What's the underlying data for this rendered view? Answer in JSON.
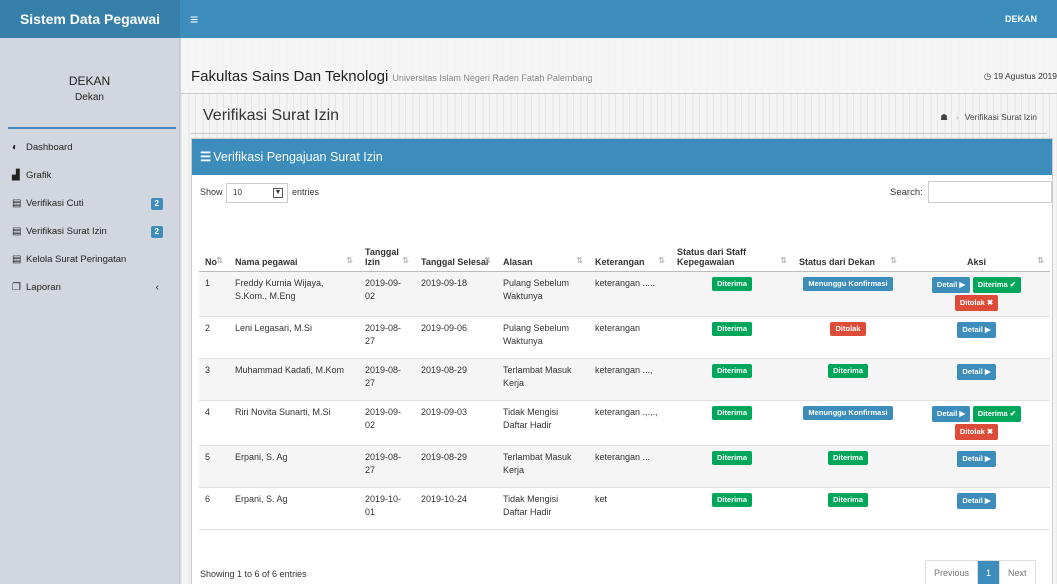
{
  "app": {
    "brand": "Sistem Data Pegawai",
    "menu_icon": "≡",
    "user_menu": "DEKAN"
  },
  "sidebar": {
    "user_name": "DEKAN",
    "user_role": "Dekan",
    "items": [
      {
        "label": "Dashboard",
        "icon": "dashboard-icon",
        "glyph": "◐"
      },
      {
        "label": "Grafik",
        "icon": "bar-chart-icon",
        "glyph": "▟"
      },
      {
        "label": "Verifikasi Cuti",
        "icon": "table-icon",
        "glyph": "▤",
        "badge": "2"
      },
      {
        "label": "Verifikasi Surat Izin",
        "icon": "table-icon",
        "glyph": "▤",
        "badge": "2"
      },
      {
        "label": "Kelola Surat Peringatan",
        "icon": "table-icon",
        "glyph": "▤"
      },
      {
        "label": "Laporan",
        "icon": "copy-icon",
        "glyph": "❐",
        "caret": "‹"
      }
    ]
  },
  "header": {
    "faculty": "Fakultas Sains Dan Teknologi",
    "university": "Universitas Islam Negeri Raden Fatah Palembang",
    "date": "◷ 19 Agustus 2019"
  },
  "page": {
    "title": "Verifikasi Surat Izin",
    "breadcrumb_home": "☗",
    "breadcrumb_current": "Verifikasi Surat Izin"
  },
  "box": {
    "title": "Verifikasi Pengajuan Surat Izin"
  },
  "controls": {
    "show": "Show",
    "length": "10",
    "entries": "entries",
    "search_label": "Search:"
  },
  "table": {
    "headers": [
      "No",
      "Nama pegawai",
      "Tanggal Izin",
      "Tanggal Selesai",
      "Alasan",
      "Keterangan",
      "Status dari Staff Kepegawaian",
      "Status dari Dekan",
      "Aksi"
    ],
    "rows": [
      {
        "no": "1",
        "nama": "Freddy Kurnia Wijaya, S.Kom., M.Eng",
        "izin": "2019-09-02",
        "selesai": "2019-09-18",
        "alasan": "Pulang Sebelum Waktunya",
        "ket": "keterangan .....",
        "staff": "Diterima",
        "dekan": "Menunggu Konfirmasi",
        "actions": "full"
      },
      {
        "no": "2",
        "nama": "Leni Legasari, M.Si",
        "izin": "2019-08-27",
        "selesai": "2019-09-06",
        "alasan": "Pulang Sebelum Waktunya",
        "ket": "keterangan",
        "staff": "Diterima",
        "dekan": "Ditolak",
        "actions": "detail"
      },
      {
        "no": "3",
        "nama": "Muhammad Kadafi, M.Kom",
        "izin": "2019-08-27",
        "selesai": "2019-08-29",
        "alasan": "Terlambat Masuk Kerja",
        "ket": "keterangan ...,",
        "staff": "Diterima",
        "dekan": "Diterima",
        "actions": "detail"
      },
      {
        "no": "4",
        "nama": "Riri Novita Sunarti, M.Si",
        "izin": "2019-09-02",
        "selesai": "2019-09-03",
        "alasan": "Tidak Mengisi Daftar Hadir",
        "ket": "keterangan .,.,.,",
        "staff": "Diterima",
        "dekan": "Menunggu Konfirmasi",
        "actions": "full"
      },
      {
        "no": "5",
        "nama": "Erpani, S. Ag",
        "izin": "2019-08-27",
        "selesai": "2019-08-29",
        "alasan": "Terlambat Masuk Kerja",
        "ket": "keterangan ...",
        "staff": "Diterima",
        "dekan": "Diterima",
        "actions": "detail"
      },
      {
        "no": "6",
        "nama": "Erpani, S. Ag",
        "izin": "2019-10-01",
        "selesai": "2019-10-24",
        "alasan": "Tidak Mengisi Daftar Hadir",
        "ket": "ket",
        "staff": "Diterima",
        "dekan": "Diterima",
        "actions": "detail"
      }
    ],
    "buttons": {
      "detail": "Detail ▶",
      "accept": "Diterima ✔",
      "reject": "Ditolak ✖"
    }
  },
  "footer": {
    "info": "Showing 1 to 6 of 6 entries",
    "previous": "Previous",
    "page": "1",
    "next": "Next"
  },
  "colors": {
    "primary": "#3c8dbc",
    "brand_dark": "#367fa9",
    "success": "#00a65a",
    "danger": "#dd4b39"
  }
}
